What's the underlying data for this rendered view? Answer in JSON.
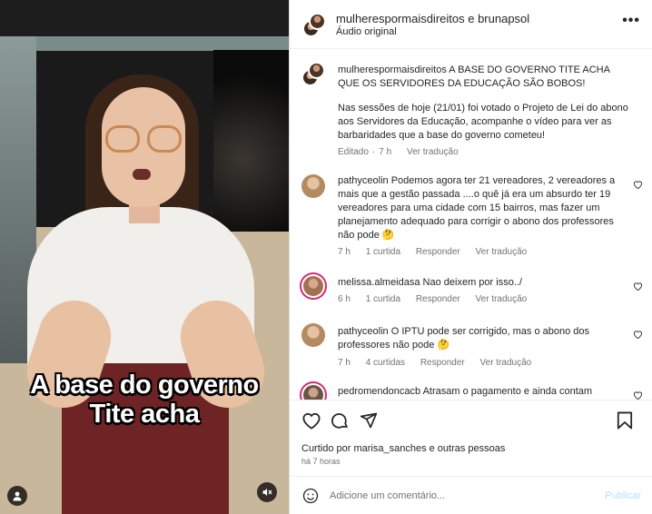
{
  "header": {
    "names": "mulherespormaisdireitos e brunapsol",
    "subtitle": "Áudio original",
    "more_label": "•••"
  },
  "video": {
    "caption_line1": "A base do governo",
    "caption_line2": "Tite acha"
  },
  "post": {
    "author": "mulherespormaisdireitos",
    "text1": "A BASE DO GOVERNO TITE ACHA QUE OS SERVIDORES DA EDUCAÇÃO SÃO BOBOS!",
    "text2": "Nas sessões de hoje (21/01) foi votado o Projeto de Lei do abono aos Servidores da Educação, acompanhe o vídeo para ver as barbaridades que a base do governo cometeu!",
    "edited": "Editado",
    "time": "7 h",
    "translate": "Ver tradução"
  },
  "comments": [
    {
      "user": "pathyceolin",
      "text": "Podemos agora ter 21 vereadores, 2 vereadores a mais que a gestão passada ....o quê já era um absurdo ter 19 vereadores para uma cidade com 15 bairros, mas fazer um planejamento adequado para corrigir o abono dos professores não pode 🤔",
      "time": "7 h",
      "likes": "1 curtida",
      "reply": "Responder",
      "translate": "Ver tradução"
    },
    {
      "user": "melissa.almeidasa",
      "text": "Nao deixem por isso../",
      "time": "6 h",
      "likes": "1 curtida",
      "reply": "Responder",
      "translate": "Ver tradução"
    },
    {
      "user": "pathyceolin",
      "text": "O IPTU pode ser corrigido, mas o abono dos professores não pode 🤔",
      "time": "7 h",
      "likes": "4 curtidas",
      "reply": "Responder",
      "translate": "Ver tradução"
    },
    {
      "user": "pedromendoncacb",
      "text": "Atrasam o pagamento e ainda contam",
      "time": "",
      "likes": "",
      "reply": "",
      "translate": ""
    }
  ],
  "actions": {
    "liked_by": "Curtido por marisa_sanches e outras pessoas",
    "ago": "há 7 horas"
  },
  "composer": {
    "placeholder": "Adicione um comentário...",
    "publish": "Publicar"
  },
  "icons": [
    "heart-icon",
    "comment-icon",
    "share-icon",
    "bookmark-icon",
    "emoji-icon",
    "user-icon",
    "mute-icon",
    "more-icon"
  ],
  "colors": {
    "accent": "#0095f6",
    "publish_disabled": "#b2dffc",
    "muted_text": "#737373",
    "story_ring": "#d62976"
  }
}
